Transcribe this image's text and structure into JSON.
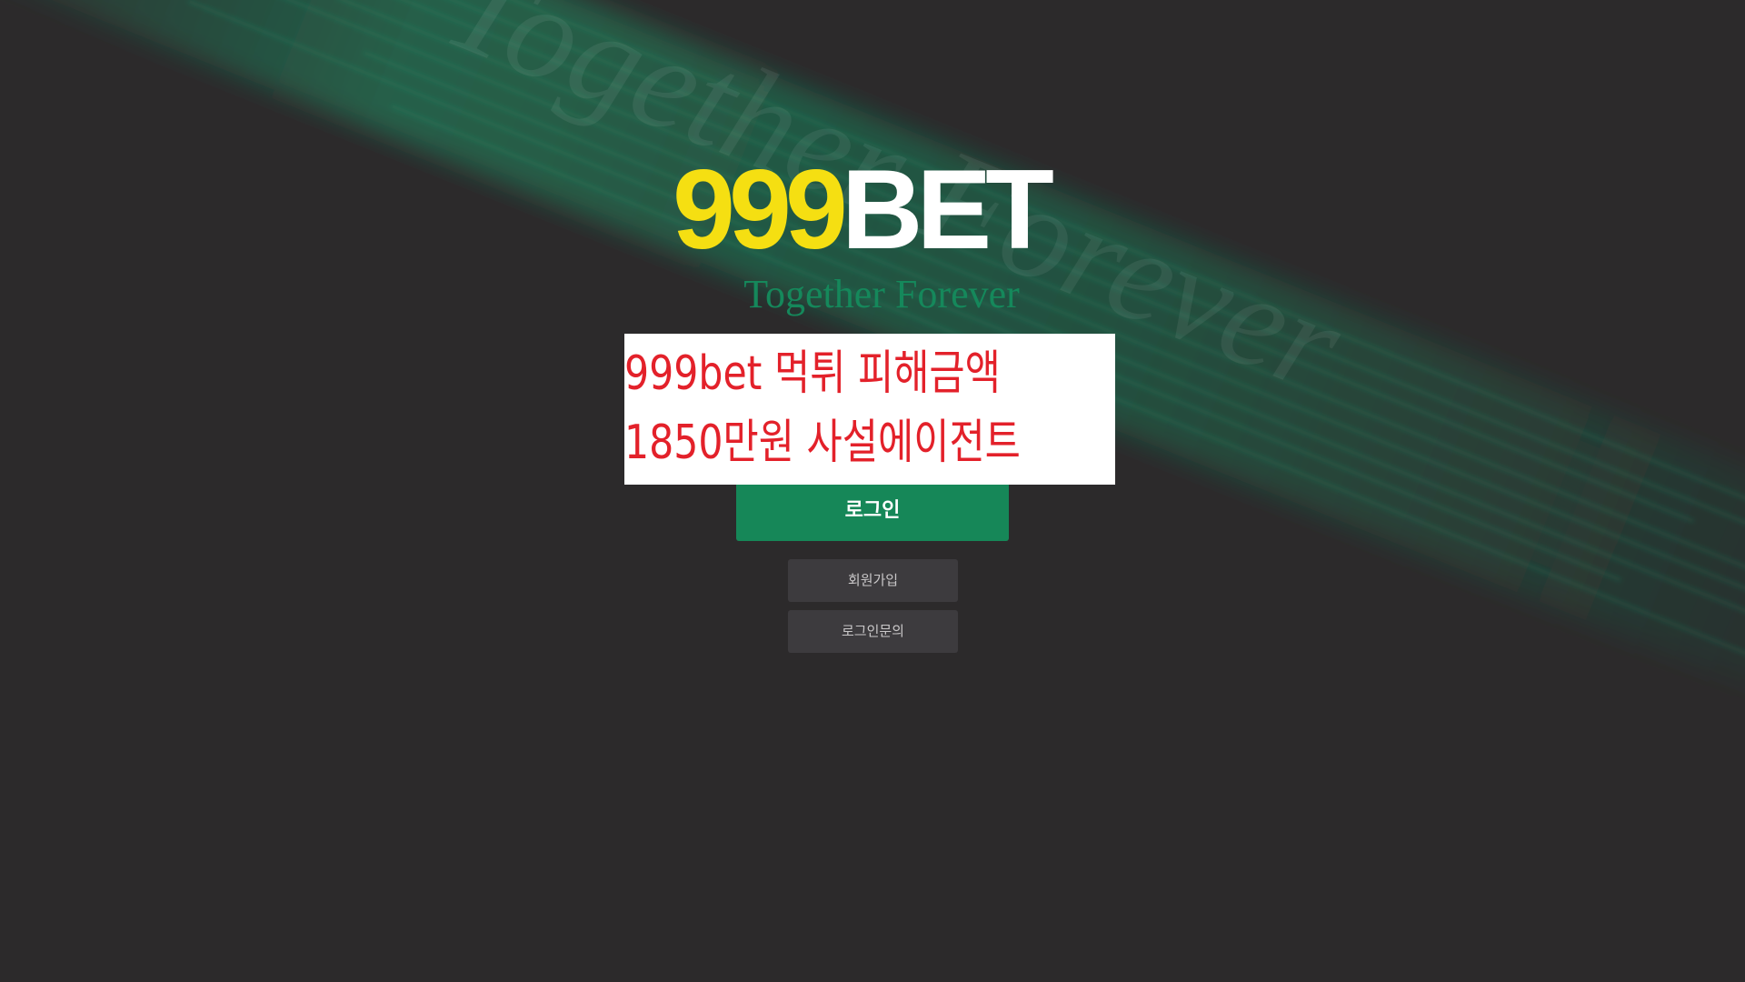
{
  "logo": {
    "number": "999",
    "word": "BET",
    "tagline": "Together Forever",
    "watermark": "Together Forever"
  },
  "notice": {
    "line1": "999bet  먹튀  피해금액",
    "line2": "1850만원  사설에이전트"
  },
  "buttons": {
    "login": "로그인",
    "join": "회원가입",
    "inquiry": "로그인문의"
  },
  "colors": {
    "background": "#2c2a2b",
    "accent_green": "#168758",
    "logo_yellow": "#f5df12",
    "notice_red": "#e3212a",
    "secondary_button": "#3d3b3e"
  }
}
